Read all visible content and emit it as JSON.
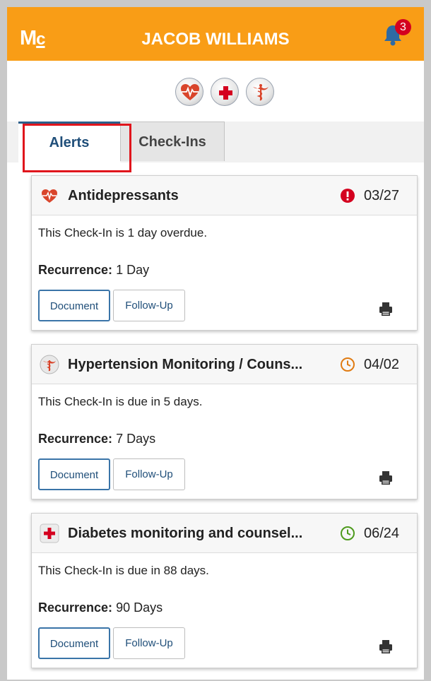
{
  "header": {
    "logo_main": "M",
    "logo_sub": "c",
    "patient_name": "JACOB WILLIAMS",
    "notification_count": "3",
    "bell_icon": "bell-icon"
  },
  "category_icons": [
    "heart-icon",
    "red-cross-icon",
    "caduceus-icon"
  ],
  "tabs": [
    {
      "label": "Alerts",
      "active": true
    },
    {
      "label": "Check-Ins",
      "active": false
    }
  ],
  "alerts": [
    {
      "title": "Antidepressants",
      "icon": "heart-icon",
      "status": "overdue",
      "status_icon": "exclamation-icon",
      "status_color": "#d4001f",
      "date": "03/27",
      "message": "This Check-In is 1 day overdue.",
      "recurrence_label": "Recurrence:",
      "recurrence_value": "1 Day",
      "document_label": "Document",
      "followup_label": "Follow-Up",
      "print_icon": "printer-icon"
    },
    {
      "title": "Hypertension Monitoring / Couns...",
      "icon": "caduceus-icon",
      "status": "due-soon",
      "status_icon": "clock-icon",
      "status_color": "#e07b12",
      "date": "04/02",
      "message": "This Check-In is due in 5 days.",
      "recurrence_label": "Recurrence:",
      "recurrence_value": "7 Days",
      "document_label": "Document",
      "followup_label": "Follow-Up",
      "print_icon": "printer-icon"
    },
    {
      "title": "Diabetes monitoring and counsel...",
      "icon": "red-cross-icon",
      "status": "upcoming",
      "status_icon": "clock-icon",
      "status_color": "#4d9a1c",
      "date": "06/24",
      "message": "This Check-In is due in 88 days.",
      "recurrence_label": "Recurrence:",
      "recurrence_value": "90 Days",
      "document_label": "Document",
      "followup_label": "Follow-Up",
      "print_icon": "printer-icon"
    }
  ],
  "colors": {
    "header": "#f99d16",
    "active_tab_text": "#1f4e79",
    "highlight_border": "#e0151c"
  }
}
